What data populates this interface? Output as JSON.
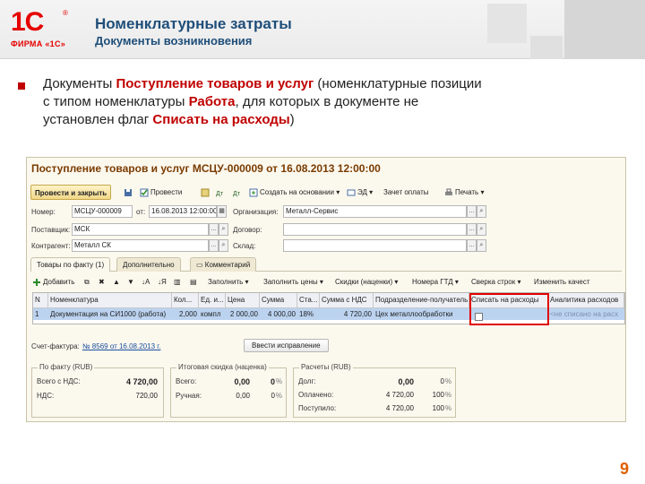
{
  "header": {
    "logo_text": "1С",
    "logo_reg": "®",
    "logo_sub": "ФИРМА «1С»",
    "title": "Номенклатурные затраты",
    "subtitle": "Документы возникновения"
  },
  "bullet": {
    "t1": "Документы ",
    "h1": "Поступление товаров и услуг",
    "t2": " (номенклатурные позиции с типом номенклатуры ",
    "h2": "Работа",
    "t3": ", для которых в документе не установлен флаг ",
    "h3": "Списать на расходы",
    "t4": ")"
  },
  "window": {
    "title": "Поступление товаров и услуг МСЦУ-000009 от 16.08.2013 12:00:00",
    "toolbar": {
      "post_close": "Провести и закрыть",
      "post": "Провести",
      "create_based": "Создать на основании",
      "ed": "ЭД",
      "payment_invoice": "Зачет оплаты",
      "print": "Печать"
    },
    "fields": {
      "number_label": "Номер:",
      "number_value": "МСЦУ-000009",
      "date_label": "от:",
      "date_value": "16.08.2013 12:00:00",
      "org_label": "Организация:",
      "org_value": "Металл-Сервис",
      "supplier_label": "Поставщик:",
      "supplier_value": "МСК",
      "contract_label": "Договор:",
      "contract_value": "",
      "counterparty_label": "Контрагент:",
      "counterparty_value": "Металл СК",
      "warehouse_label": "Склад:",
      "warehouse_value": ""
    },
    "tabs": [
      "Товары по факту (1)",
      "Дополнительно",
      "Комментарий"
    ],
    "grid_toolbar": {
      "add": "Добавить",
      "fill": "Заполнить",
      "fill_prices": "Заполнить цены",
      "discounts": "Скидки (наценки)",
      "gtd": "Номера ГТД",
      "reconcile": "Сверка строк",
      "change": "Изменить качест"
    },
    "grid_headers": [
      "N",
      "Номенклатура",
      "Кол...",
      "Ед. и...",
      "Цена",
      "Сумма",
      "Ста...",
      "Сумма с НДС",
      "Подразделение-получатель",
      "Списать на расходы",
      "Аналитика расходов"
    ],
    "grid_row": [
      "1",
      "Документация на СИ1000 (работа)",
      "2,000",
      "компл",
      "2 000,00",
      "4 000,00",
      "18%",
      "4 720,00",
      "Цех металлообработки",
      "",
      "<не списано на расх"
    ],
    "invoice_label": "Счет-фактура:",
    "invoice_link": "№ 8569 от 16.08.2013 г.",
    "correction_button": "Ввести исправление",
    "fact_group": {
      "title": "По факту (RUB)",
      "total_label": "Всего с НДС:",
      "total_value": "4 720,00",
      "vat_label": "НДС:",
      "vat_value": "720,00"
    },
    "discount_group": {
      "title": "Итоговая скидка (наценка)",
      "total_label": "Всего:",
      "total_value": "0,00",
      "total_pct": "0",
      "manual_label": "Ручная:",
      "manual_value": "0,00",
      "manual_pct": "0"
    },
    "settlements_group": {
      "title": "Расчеты (RUB)",
      "debt_label": "Долг:",
      "debt_value": "0,00",
      "debt_pct": "0",
      "paid_label": "Оплачено:",
      "paid_value": "4 720,00",
      "paid_pct": "100",
      "received_label": "Поступило:",
      "received_value": "4 720,00",
      "received_pct": "100"
    }
  },
  "page_number": "9"
}
